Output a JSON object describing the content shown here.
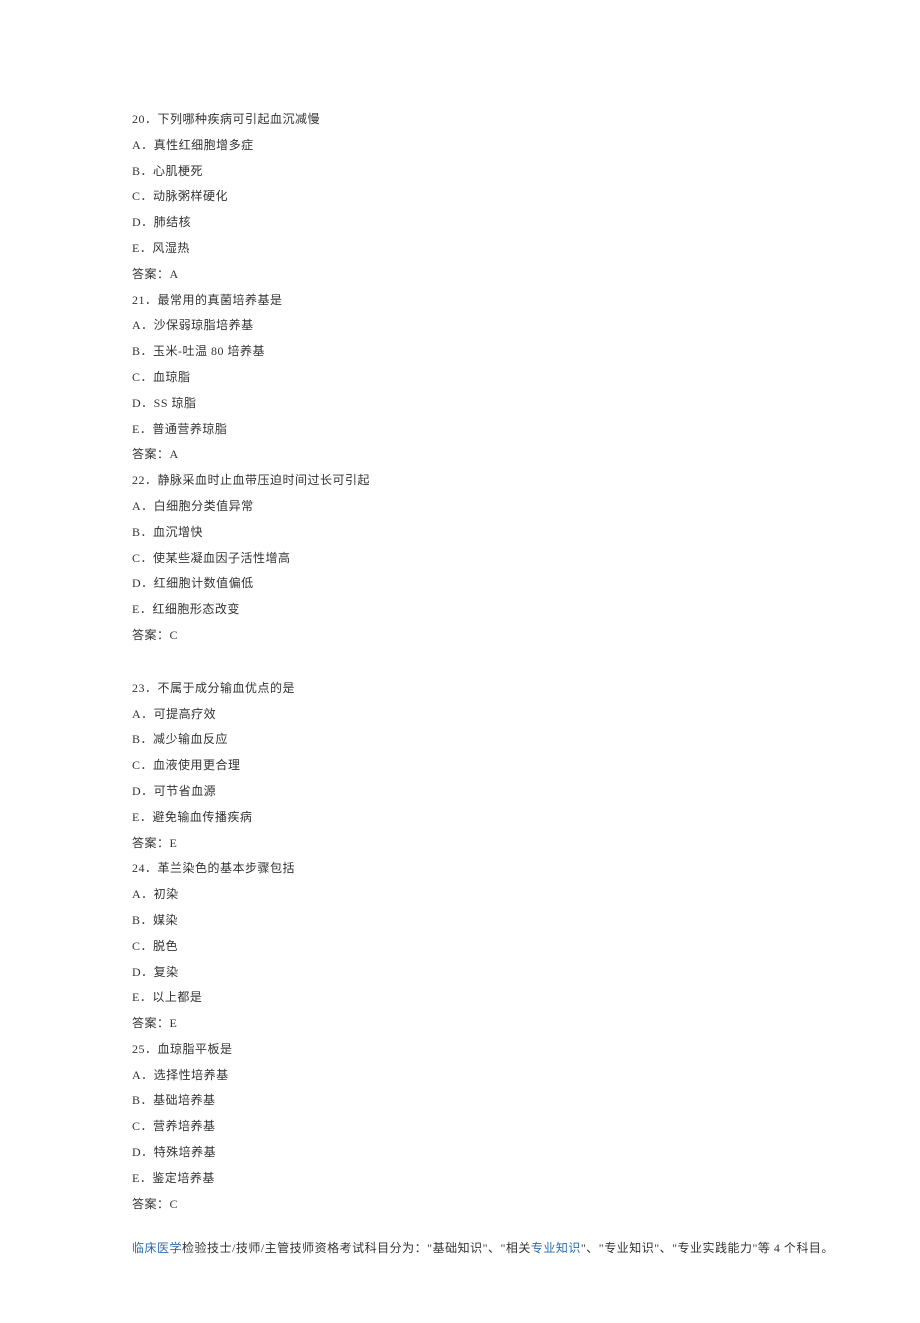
{
  "questions": [
    {
      "number": "20",
      "stem": "下列哪种疾病可引起血沉减慢",
      "options": [
        "A．真性红细胞增多症",
        "B．心肌梗死",
        "C．动脉粥样硬化",
        "D．肺结核",
        "E．风湿热"
      ],
      "answer": "答案：A"
    },
    {
      "number": "21",
      "stem": "最常用的真菌培养基是",
      "options": [
        "A．沙保弱琼脂培养基",
        "B．玉米-吐温 80 培养基",
        "C．血琼脂",
        "D．SS 琼脂",
        "E．普通营养琼脂"
      ],
      "answer": "答案：A"
    },
    {
      "number": "22",
      "stem": "静脉采血时止血带压迫时间过长可引起",
      "options": [
        "A．白细胞分类值异常",
        "B．血沉增快",
        "C．使某些凝血因子活性增高",
        "D．红细胞计数值偏低",
        "E．红细胞形态改变"
      ],
      "answer": "答案：C"
    },
    {
      "number": "23",
      "stem": "不属于成分输血优点的是",
      "options": [
        "A．可提高疗效",
        "B．减少输血反应",
        "C．血液使用更合理",
        "D．可节省血源",
        "E．避免输血传播疾病"
      ],
      "answer": "答案：E"
    },
    {
      "number": "24",
      "stem": "革兰染色的基本步骤包括",
      "options": [
        "A．初染",
        "B．媒染",
        "C．脱色",
        "D．复染",
        "E．以上都是"
      ],
      "answer": "答案：E"
    },
    {
      "number": "25",
      "stem": "血琼脂平板是",
      "options": [
        "A．选择性培养基",
        "B．基础培养基",
        "C．营养培养基",
        "D．特殊培养基",
        "E．鉴定培养基"
      ],
      "answer": "答案：C"
    }
  ],
  "footer": {
    "link1": "临床医学",
    "mid1": "检验技士/技师/主管技师资格考试科目分为：\"基础知识\"、\"相关",
    "link2": "专业知识",
    "mid2": "\"、\"专业知识\"、\"专业实践能力\"等 4 个科目。"
  },
  "stem_prefix": {
    "20": "20．",
    "21": "21．",
    "22": "22．",
    "23": "23．",
    "24": "24．",
    "25": "25．"
  }
}
